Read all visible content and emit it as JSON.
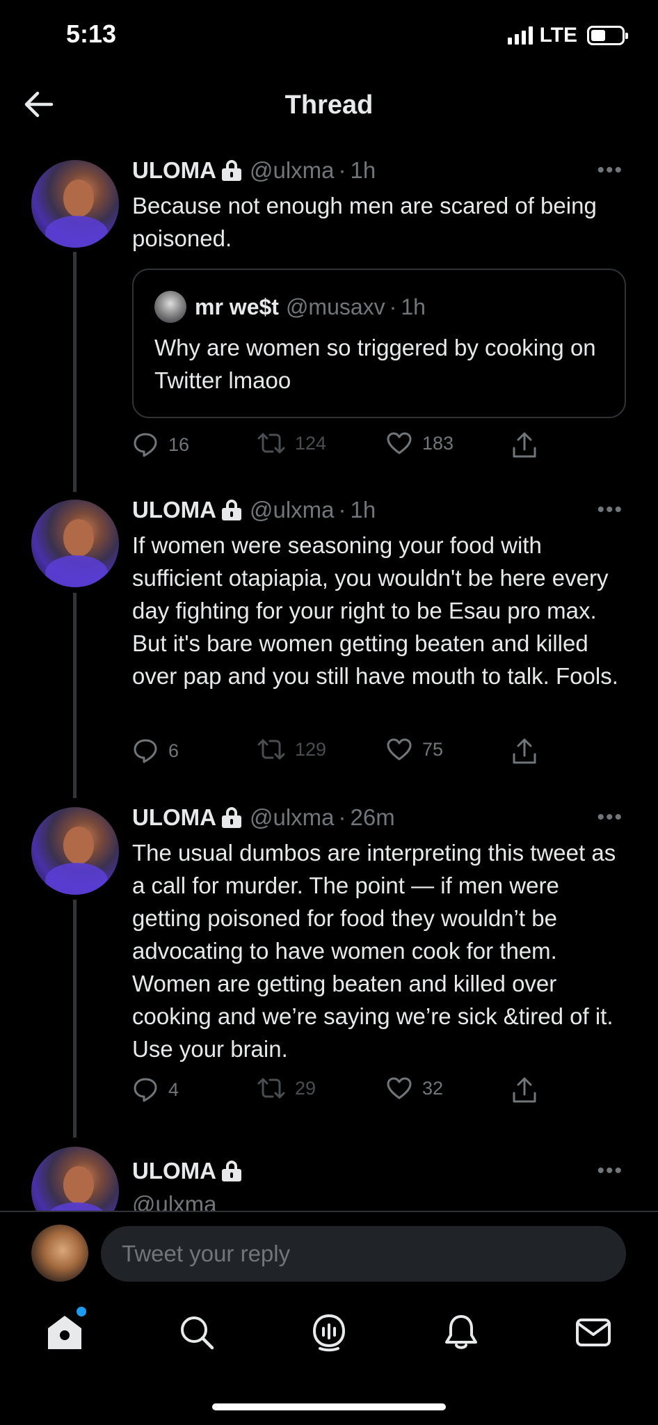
{
  "status": {
    "time": "5:13",
    "network": "LTE"
  },
  "header": {
    "title": "Thread"
  },
  "tweets": [
    {
      "name": "ULOMA",
      "handle": "@ulxma",
      "sep": "·",
      "time": "1h",
      "text": "Because not enough men are scared of being poisoned.",
      "quote": {
        "name": "mr we$t",
        "handle": "@musaxv",
        "sep": "·",
        "time": "1h",
        "text": "Why are women so triggered by cooking on Twitter lmaoo"
      },
      "replies": "16",
      "retweets": "124",
      "likes": "183"
    },
    {
      "name": "ULOMA",
      "handle": "@ulxma",
      "sep": "·",
      "time": "1h",
      "text": "If women were seasoning your food with sufficient otapiapia, you wouldn't be here every day fighting for your right to be Esau pro max. But it's bare women getting beaten and killed over pap and you still have mouth to talk. Fools.",
      "replies": "6",
      "retweets": "129",
      "likes": "75"
    },
    {
      "name": "ULOMA",
      "handle": "@ulxma",
      "sep": "·",
      "time": "26m",
      "text": "The usual dumbos are interpreting this tweet as a call for murder. The point — if men were getting poisoned for food they wouldn’t be advocating to have women cook for them. Women are getting beaten and killed over cooking and we’re saying we’re sick &tired of it. Use your brain.",
      "replies": "4",
      "retweets": "29",
      "likes": "32"
    },
    {
      "name": "ULOMA",
      "handle": "@ulxma"
    }
  ],
  "more": "•••",
  "reply_bar": {
    "placeholder": "Tweet your reply"
  },
  "tabs": [
    "home-icon",
    "search-icon",
    "spaces-icon",
    "notifications-icon",
    "messages-icon"
  ],
  "colors": {
    "background": "#000000",
    "text": "#e7e9ea",
    "muted": "#71767b",
    "accent": "#1d9bf0"
  }
}
